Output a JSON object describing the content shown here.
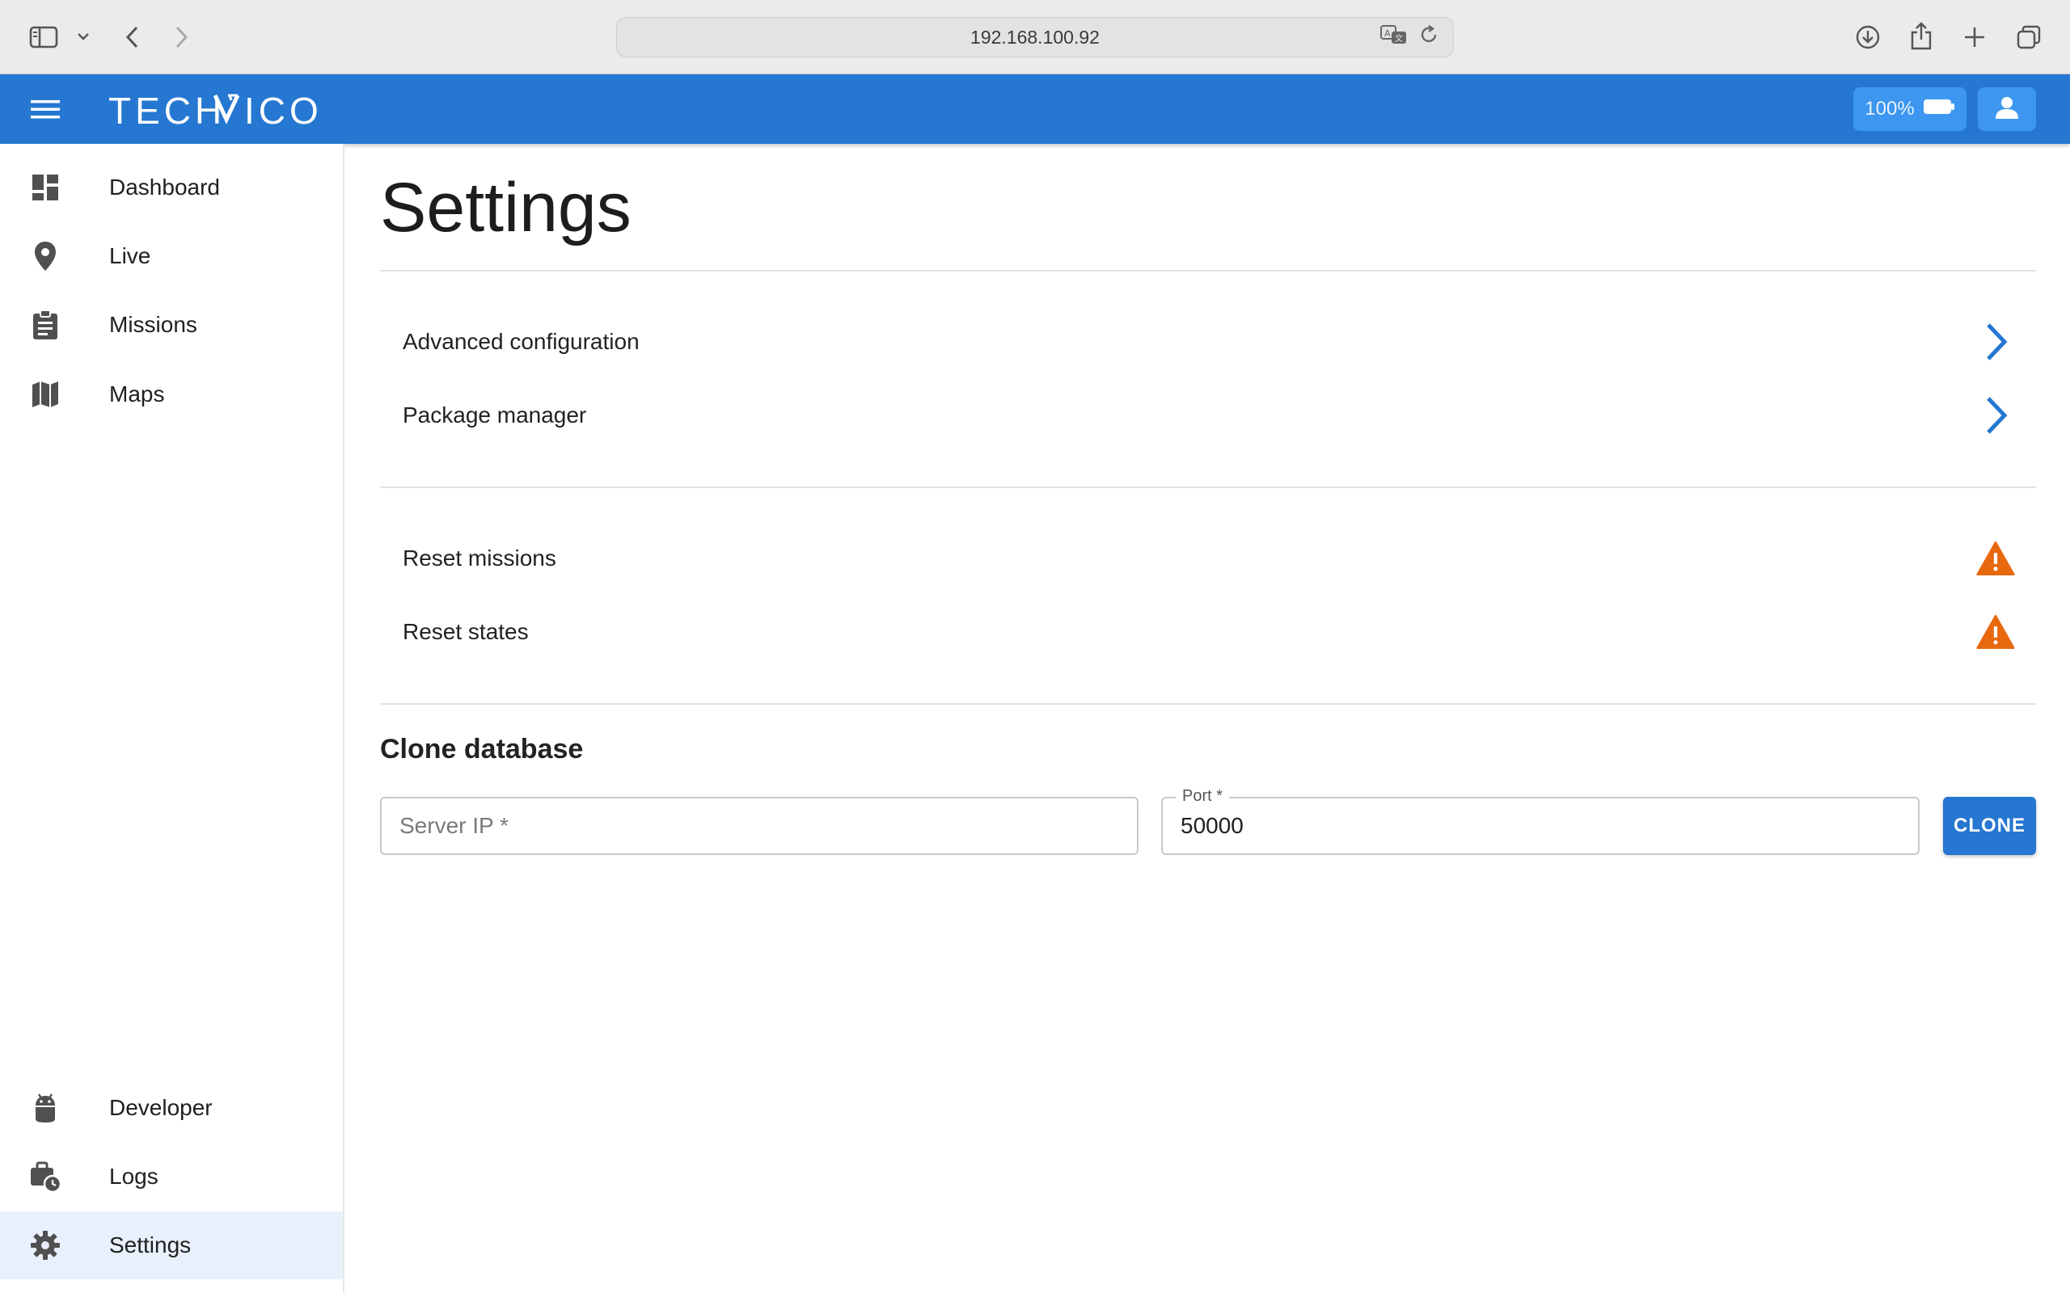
{
  "browser": {
    "url": "192.168.100.92"
  },
  "header": {
    "logo_text": "TECHNICO",
    "battery_label": "100%",
    "brand_color": "#2577d1"
  },
  "sidebar": {
    "items": [
      {
        "label": "Dashboard",
        "icon": "dashboard-icon"
      },
      {
        "label": "Live",
        "icon": "location-pin-icon"
      },
      {
        "label": "Missions",
        "icon": "clipboard-icon"
      },
      {
        "label": "Maps",
        "icon": "map-icon"
      },
      {
        "label": "Developer",
        "icon": "android-icon"
      },
      {
        "label": "Logs",
        "icon": "briefcase-clock-icon"
      },
      {
        "label": "Settings",
        "icon": "gear-icon",
        "active": true
      }
    ]
  },
  "main": {
    "title": "Settings",
    "navigation_rows": [
      {
        "label": "Advanced configuration",
        "icon": "chevron-right-icon"
      },
      {
        "label": "Package manager",
        "icon": "chevron-right-icon"
      }
    ],
    "reset_rows": [
      {
        "label": "Reset missions",
        "icon": "warning-icon"
      },
      {
        "label": "Reset states",
        "icon": "warning-icon"
      }
    ],
    "clone": {
      "section_title": "Clone database",
      "server_ip_placeholder": "Server IP *",
      "server_ip_value": "",
      "port_label": "Port *",
      "port_value": "50000",
      "button_label": "CLONE"
    }
  },
  "colors": {
    "accent": "#2577d1",
    "warning": "#e8680f",
    "active_nav_bg": "#e8f1fb"
  }
}
